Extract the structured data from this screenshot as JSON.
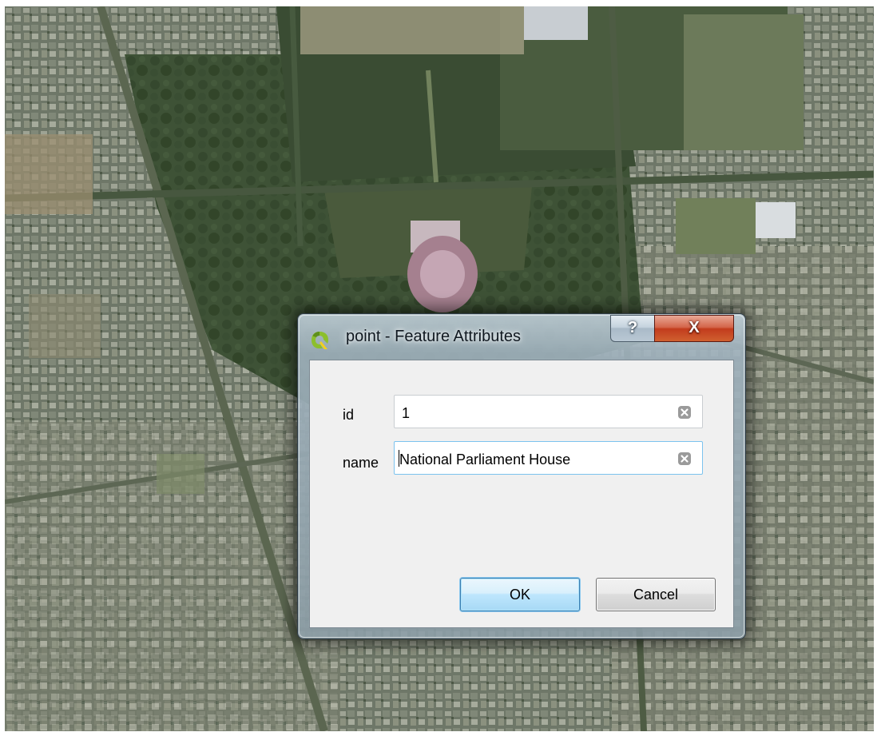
{
  "map": {
    "description_icon": "satellite-imagery"
  },
  "dialog": {
    "title": "point - Feature Attributes",
    "app_icon": "qgis-icon",
    "help_label": "?",
    "close_label": "X",
    "fields": [
      {
        "label": "id",
        "value": "1"
      },
      {
        "label": "name",
        "value": "National Parliament House"
      }
    ],
    "ok_label": "OK",
    "cancel_label": "Cancel"
  },
  "colors": {
    "close_red": "#c23c1d",
    "focus_blue": "#3c7fb1",
    "qgis_green": "#8cbf2c",
    "qgis_yellow": "#f2d01e"
  }
}
